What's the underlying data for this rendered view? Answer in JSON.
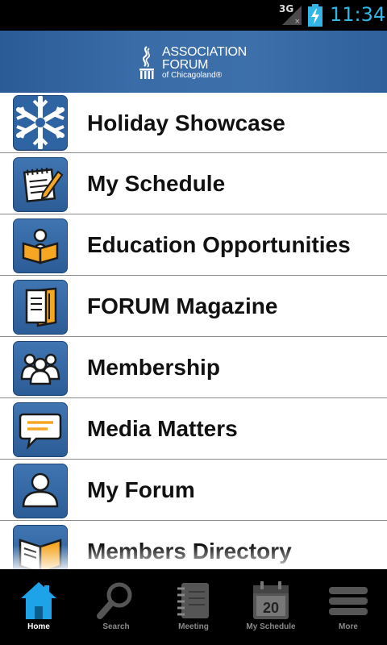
{
  "status_bar": {
    "network": "3G",
    "time": "11:34",
    "signal_icon": "signal-icon",
    "battery_icon": "battery-charging-icon"
  },
  "header": {
    "logo_line1": "ASSOCIATION",
    "logo_line2": "FORUM",
    "logo_line3": "of Chicagoland®"
  },
  "menu": {
    "items": [
      {
        "label": "Holiday Showcase",
        "icon": "snowflake-icon"
      },
      {
        "label": "My Schedule",
        "icon": "notepad-pencil-icon"
      },
      {
        "label": "Education Opportunities",
        "icon": "reader-book-icon"
      },
      {
        "label": "FORUM Magazine",
        "icon": "magazine-icon"
      },
      {
        "label": "Membership",
        "icon": "group-people-icon"
      },
      {
        "label": "Media Matters",
        "icon": "speech-bubble-icon"
      },
      {
        "label": "My Forum",
        "icon": "user-profile-icon"
      },
      {
        "label": "Members Directory",
        "icon": "open-book-icon"
      }
    ]
  },
  "tabs": [
    {
      "label": "Home",
      "icon": "home-icon",
      "active": true
    },
    {
      "label": "Search",
      "icon": "search-icon",
      "active": false
    },
    {
      "label": "Meeting",
      "icon": "notebook-icon",
      "active": false
    },
    {
      "label": "My Schedule",
      "icon": "calendar-icon",
      "active": false,
      "calendar_day": "20"
    },
    {
      "label": "More",
      "icon": "more-menu-icon",
      "active": false
    }
  ],
  "colors": {
    "accent": "#33b5e5",
    "header_blue": "#3a6ca8",
    "icon_tile_blue": "#2c5c96",
    "icon_orange": "#f5a623",
    "tab_active": "#1ea3e8",
    "tab_inactive": "#555555"
  }
}
